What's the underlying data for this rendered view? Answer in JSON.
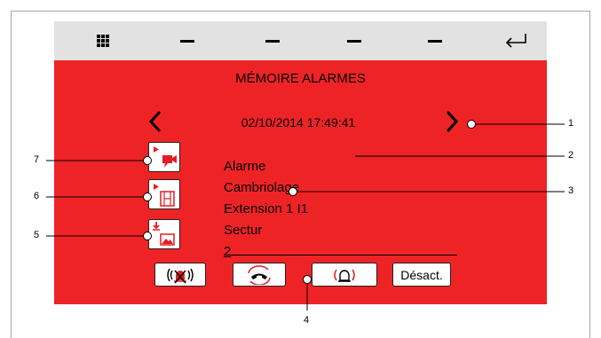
{
  "screen": {
    "title": "MÉMOIRE ALARMES",
    "datetime": "02/10/2014  17:49:41",
    "alarm_lines": [
      "Alarme",
      "Cambriolage",
      "Extension 1 I1",
      "Sectur",
      "2"
    ]
  },
  "toolbar": {
    "icons": [
      "grid-icon",
      "dash",
      "dash",
      "dash",
      "dash",
      "return-icon"
    ]
  },
  "bottom_buttons": {
    "deactivate_label": "Désact."
  },
  "callouts": [
    "1",
    "2",
    "3",
    "4",
    "5",
    "6",
    "7"
  ],
  "colors": {
    "screen": "#ee2326",
    "topbar": "#e2e2e2"
  }
}
